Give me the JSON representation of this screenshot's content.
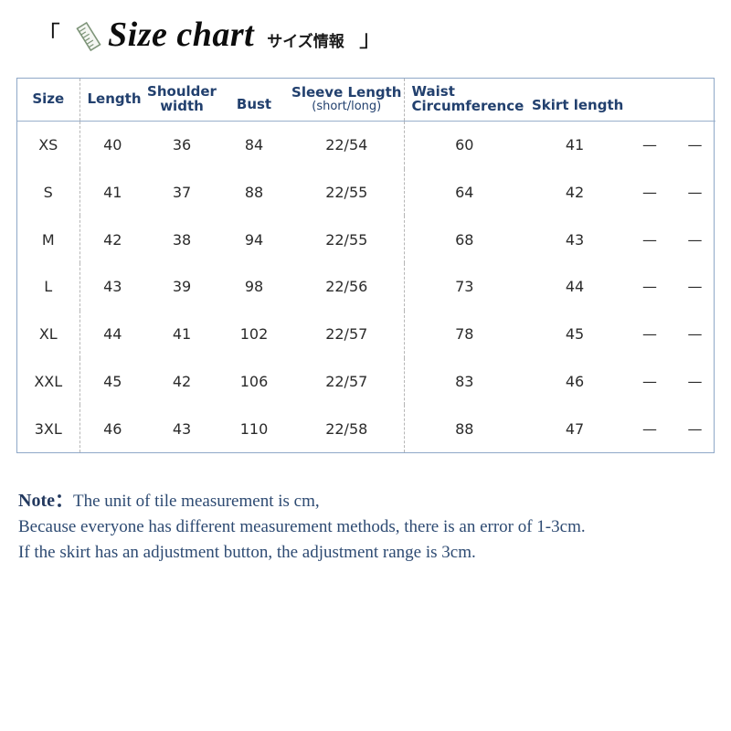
{
  "header": {
    "bracket_left": "「",
    "bracket_right": "」",
    "title_en": "Size chart",
    "title_jp": "サイズ情報",
    "icon": "ruler-icon"
  },
  "table": {
    "columns": [
      {
        "key": "size",
        "label": "Size",
        "sub": ""
      },
      {
        "key": "length",
        "label": "Length",
        "sub": ""
      },
      {
        "key": "shoulder",
        "label": "Shoulder",
        "sub": "width"
      },
      {
        "key": "bust",
        "label": "Bust",
        "sub": ""
      },
      {
        "key": "sleeve",
        "label": "Sleeve Length",
        "sub": "(short/long)"
      },
      {
        "key": "waist",
        "label": "Waist",
        "sub": "Circumference"
      },
      {
        "key": "skirt",
        "label": "Skirt length",
        "sub": ""
      },
      {
        "key": "extra1",
        "label": "",
        "sub": ""
      },
      {
        "key": "extra2",
        "label": "",
        "sub": ""
      }
    ],
    "rows": [
      {
        "size": "XS",
        "length": "40",
        "shoulder": "36",
        "bust": "84",
        "sleeve": "22/54",
        "waist": "60",
        "skirt": "41",
        "extra1": "—",
        "extra2": "—"
      },
      {
        "size": "S",
        "length": "41",
        "shoulder": "37",
        "bust": "88",
        "sleeve": "22/55",
        "waist": "64",
        "skirt": "42",
        "extra1": "—",
        "extra2": "—"
      },
      {
        "size": "M",
        "length": "42",
        "shoulder": "38",
        "bust": "94",
        "sleeve": "22/55",
        "waist": "68",
        "skirt": "43",
        "extra1": "—",
        "extra2": "—"
      },
      {
        "size": "L",
        "length": "43",
        "shoulder": "39",
        "bust": "98",
        "sleeve": "22/56",
        "waist": "73",
        "skirt": "44",
        "extra1": "—",
        "extra2": "—"
      },
      {
        "size": "XL",
        "length": "44",
        "shoulder": "41",
        "bust": "102",
        "sleeve": "22/57",
        "waist": "78",
        "skirt": "45",
        "extra1": "—",
        "extra2": "—"
      },
      {
        "size": "XXL",
        "length": "45",
        "shoulder": "42",
        "bust": "106",
        "sleeve": "22/57",
        "waist": "83",
        "skirt": "46",
        "extra1": "—",
        "extra2": "—"
      },
      {
        "size": "3XL",
        "length": "46",
        "shoulder": "43",
        "bust": "110",
        "sleeve": "22/58",
        "waist": "88",
        "skirt": "47",
        "extra1": "—",
        "extra2": "—"
      }
    ]
  },
  "note": {
    "label": "Note：",
    "line1": "The unit of tile measurement is cm,",
    "line2": "Because everyone has different measurement methods, there is an error of 1-3cm.",
    "line3": "If the skirt has an adjustment button, the adjustment range is 3cm."
  },
  "colors": {
    "header_text": "#22406e",
    "size_label": "#2a5090",
    "value_text": "#2b2b2b",
    "note_text": "#2d4a72",
    "table_border": "#8fa8c8",
    "dashed_sep": "#b6b6b6",
    "ruler_stroke": "#7d9478"
  }
}
